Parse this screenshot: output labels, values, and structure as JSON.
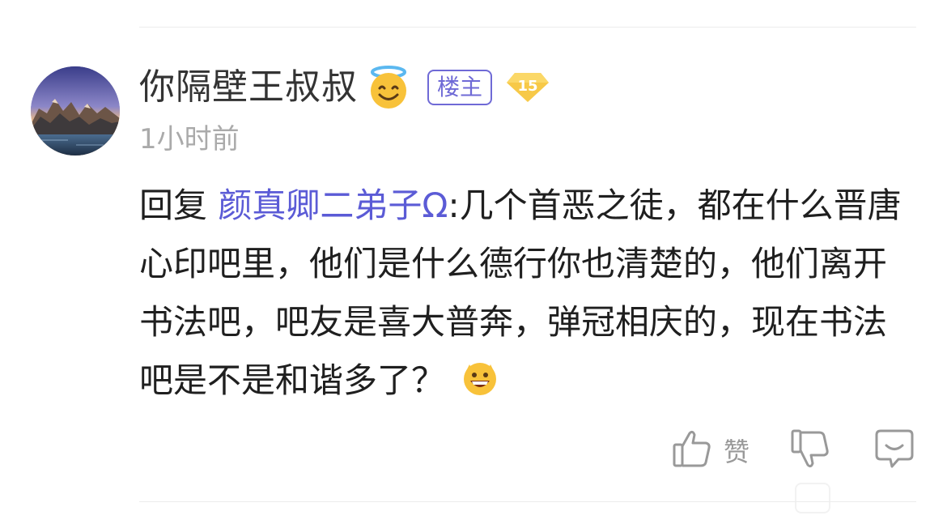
{
  "comment": {
    "username": "你隔壁王叔叔",
    "owner_badge": "楼主",
    "level": "15",
    "time": "1小时前",
    "reply_prefix": "回复 ",
    "reply_target": "颜真卿二弟子Ω",
    "body": ":几个首恶之徒，都在什么晋唐心印吧里，他们是什么德行你也清楚的，他们离开书法吧，吧友是喜大普奔，弹冠相庆的，现在书法吧是不是和谐多了？",
    "icons": {
      "avatar": "mountain-lake-avatar",
      "username_emoji": "smiling-face-with-halo-emoji",
      "level_badge": "diamond-level-badge-icon",
      "trailing_emoji": "grinning-face-emoji"
    }
  },
  "actions": {
    "like_label": "赞",
    "like_icon": "thumbs-up-icon",
    "dislike_icon": "thumbs-down-icon",
    "comment_icon": "comment-bubble-icon"
  },
  "colors": {
    "accent": "#5b5bd6",
    "badge_border": "#6f6ad6",
    "level_gold": "#f5c542",
    "muted_text": "#aaaaaa",
    "icon_gray": "#999999"
  }
}
